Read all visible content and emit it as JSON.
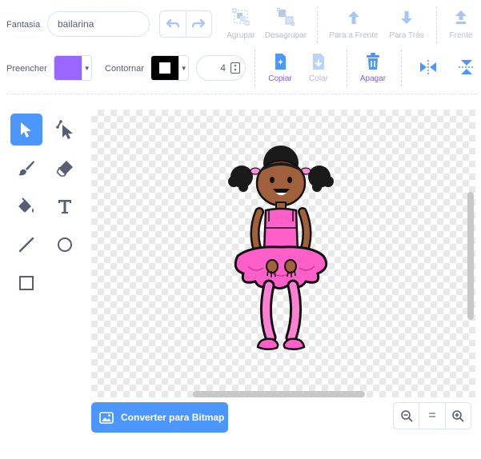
{
  "costume": {
    "label": "Fantasia",
    "name": "bailarina"
  },
  "toolbar": {
    "undo_icon": "undo-icon",
    "redo_icon": "redo-icon",
    "group": "Agrupar",
    "ungroup": "Desagrupar",
    "forward": "Para a Frente",
    "backward": "Para Trás",
    "front": "Frente",
    "copy": "Copiar",
    "paste": "Colar",
    "delete": "Apagar"
  },
  "style": {
    "fill_label": "Preencher",
    "fill_color": "#9966ff",
    "outline_label": "Contornar",
    "outline_color": "#000000",
    "stroke_width": "4"
  },
  "tools": [
    {
      "name": "select-tool",
      "icon": "arrow-select-icon",
      "selected": true
    },
    {
      "name": "reshape-tool",
      "icon": "reshape-icon"
    },
    {
      "name": "brush-tool",
      "icon": "brush-icon"
    },
    {
      "name": "eraser-tool",
      "icon": "eraser-icon"
    },
    {
      "name": "fill-tool",
      "icon": "paint-bucket-icon"
    },
    {
      "name": "text-tool",
      "icon": "text-icon"
    },
    {
      "name": "line-tool",
      "icon": "line-icon"
    },
    {
      "name": "circle-tool",
      "icon": "circle-icon"
    },
    {
      "name": "rectangle-tool",
      "icon": "rectangle-icon"
    }
  ],
  "canvas": {
    "sprite": "ballerina-sprite",
    "colors": {
      "skin": "#a0603c",
      "outfit": "#ff5fc8",
      "hair": "#1a1a1a",
      "bow": "#ff8fd8"
    }
  },
  "footer": {
    "convert_label": "Converter para Bitmap",
    "zoom_out": "zoom-out-icon",
    "zoom_reset": "=",
    "zoom_in": "zoom-in-icon"
  },
  "colors": {
    "accent": "#4c97ff",
    "secondary": "#855cd6",
    "text": "#575e75"
  }
}
